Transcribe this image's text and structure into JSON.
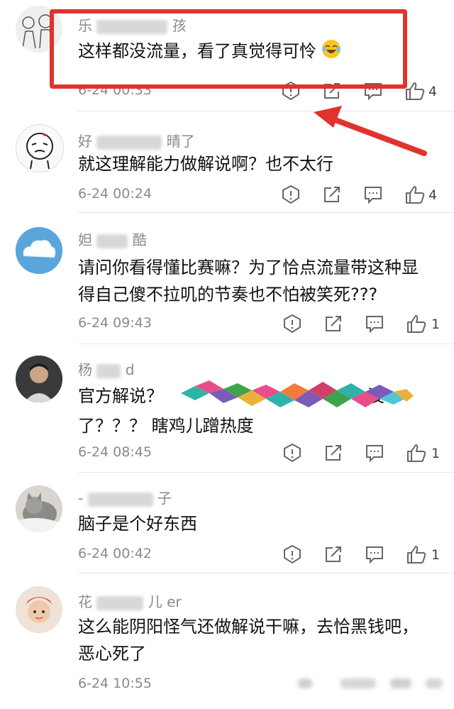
{
  "colors": {
    "annotation": "#e0332d",
    "meta_text": "#8a8a8a",
    "body_text": "#111111"
  },
  "comments": [
    {
      "username_parts": [
        "乐",
        "孩"
      ],
      "text": "这样都没流量，看了真觉得可怜",
      "emoji": "laughing-crying-emoji",
      "time": "6-24 00:33",
      "likes": "4"
    },
    {
      "username_parts": [
        "好",
        "晴了"
      ],
      "text": "就这理解能力做解说啊？也不太行",
      "time": "6-24 00:24",
      "likes": "4"
    },
    {
      "username_parts": [
        "妲",
        "酷"
      ],
      "text": "请问你看得懂比赛嘛？为了恰点流量带这种显得自己傻不拉叽的节奏也不怕被笑死???",
      "time": "6-24 09:43",
      "likes": "1"
    },
    {
      "username_parts": [
        "杨",
        "d"
      ],
      "text_before_smear": "官方解说？",
      "text_after_smear": "没",
      "text_line2": "了？？？ 瞎鸡儿蹭热度",
      "time": "6-24 08:45",
      "likes": "1"
    },
    {
      "username_parts": [
        "-",
        "子"
      ],
      "text": "脑子是个好东西",
      "time": "6-24 00:42",
      "likes": "1"
    },
    {
      "username_parts": [
        "花",
        "儿 er"
      ],
      "text": "这么能阴阳怪气还做解说干嘛，去恰黑钱吧，恶心死了",
      "time": "6-24 10:55",
      "likes": ""
    }
  ],
  "icons": [
    "report-icon",
    "share-icon",
    "reply-icon",
    "like-thumb-icon"
  ]
}
